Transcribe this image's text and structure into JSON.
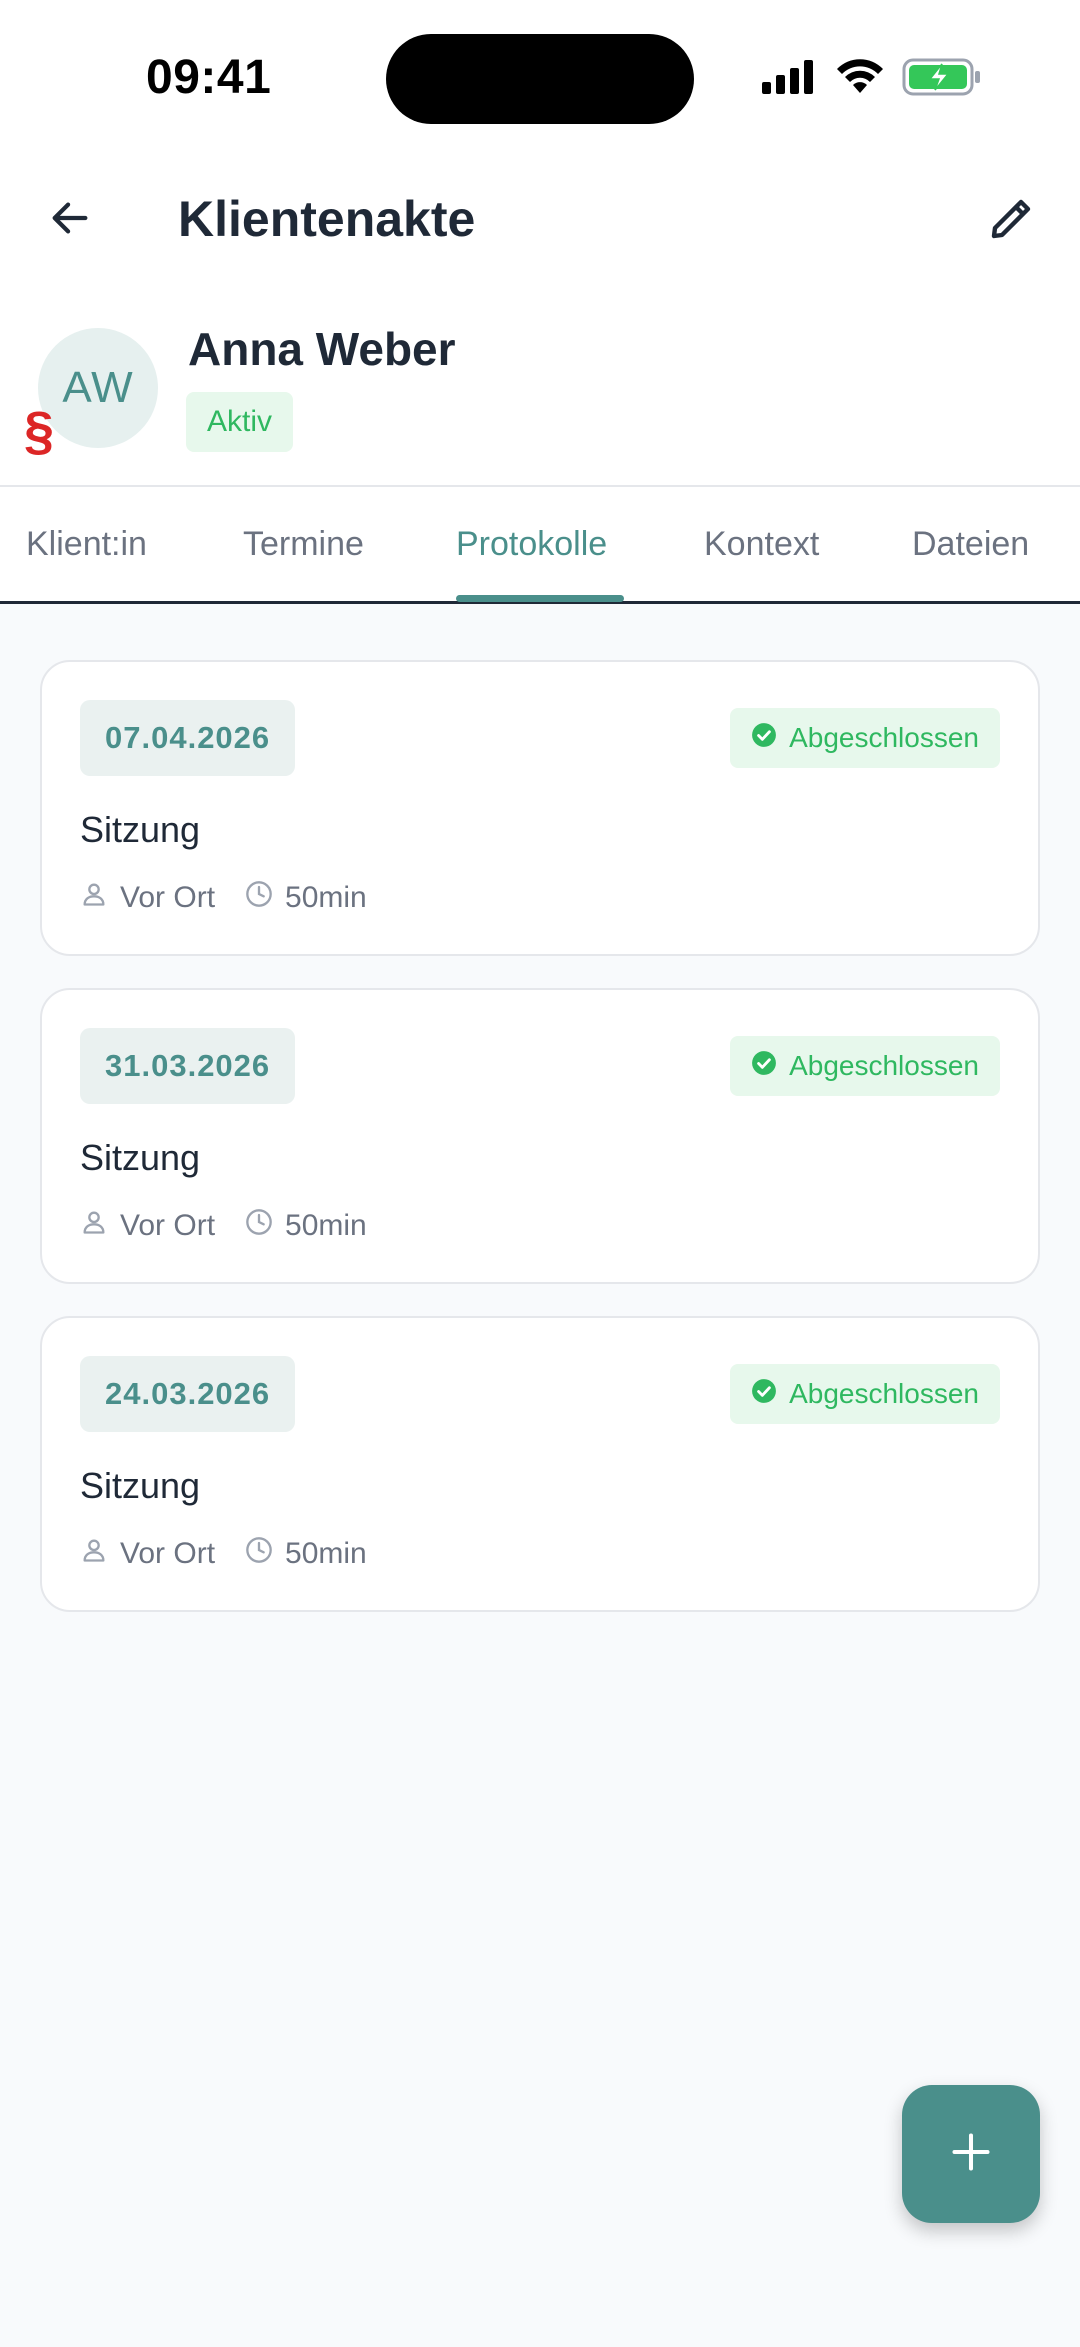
{
  "status_bar": {
    "time": "09:41",
    "icons": [
      "signal-icon",
      "wifi-icon",
      "battery-charging-icon"
    ]
  },
  "header": {
    "title": "Klientenakte",
    "back_icon": "arrow-left-icon",
    "edit_icon": "pencil-icon"
  },
  "client": {
    "initials": "AW",
    "name": "Anna Weber",
    "status": "Aktiv",
    "legal_marker": "§"
  },
  "tabs": [
    {
      "label": "Klient:in",
      "active": false
    },
    {
      "label": "Termine",
      "active": false
    },
    {
      "label": "Protokolle",
      "active": true
    },
    {
      "label": "Kontext",
      "active": false
    },
    {
      "label": "Dateien",
      "active": false
    }
  ],
  "protocols": [
    {
      "date": "07.04.2026",
      "status": "Abgeschlossen",
      "title": "Sitzung",
      "location": "Vor Ort",
      "duration": "50min"
    },
    {
      "date": "31.03.2026",
      "status": "Abgeschlossen",
      "title": "Sitzung",
      "location": "Vor Ort",
      "duration": "50min"
    },
    {
      "date": "24.03.2026",
      "status": "Abgeschlossen",
      "title": "Sitzung",
      "location": "Vor Ort",
      "duration": "50min"
    }
  ],
  "fab": {
    "icon": "plus-icon"
  },
  "colors": {
    "accent": "#4a8f8b",
    "success": "#2fb860",
    "success_bg": "#e7f8ec",
    "danger": "#dc2626",
    "background": "#f8fafc"
  }
}
